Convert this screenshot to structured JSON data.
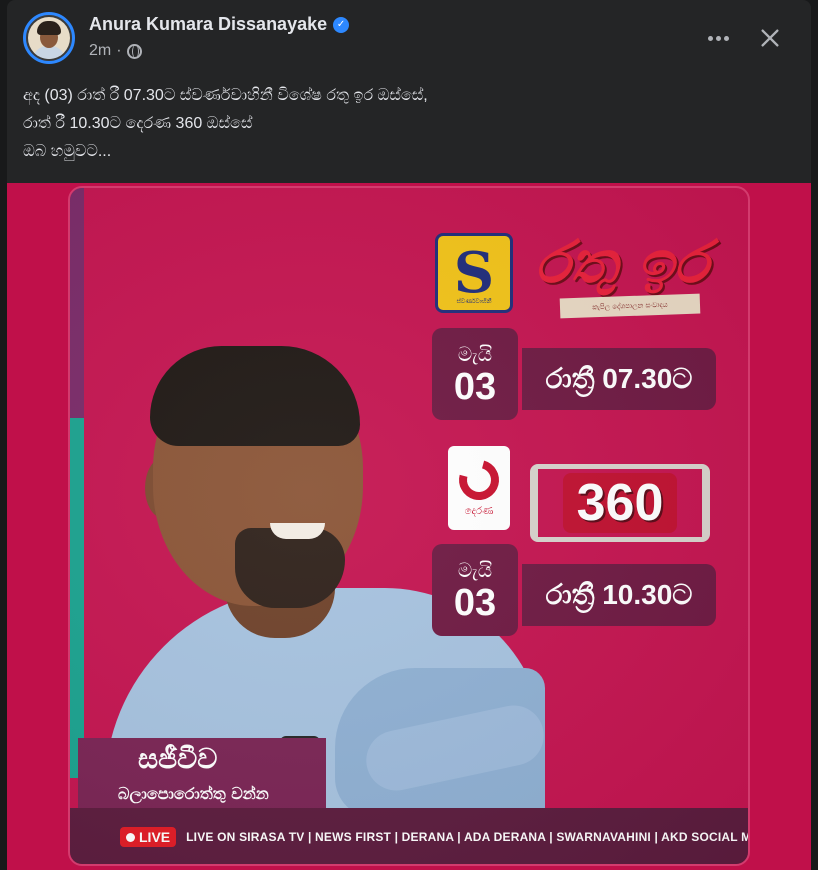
{
  "post": {
    "author_name": "Anura Kumara Dissanayake",
    "verified_badge": "✓",
    "timestamp": "2m",
    "separator": "·",
    "privacy_icon": "globe-icon",
    "more_icon": "more-options-icon",
    "close_icon": "close-icon",
    "caption_lines": [
      "අද (03) රාත් රී 07.30ට ස්වර්ණවාහිනී විශේෂ රතු ඉර ඔස්සේ,",
      "රාත් රී 10.30ට දෙරණ 360 ඔස්සේ",
      "ඔබ හමුවට..."
    ]
  },
  "poster": {
    "channel1_logo_text": "ස්වර්ණවාහිනී",
    "show1_title": "රතු ඉර",
    "show1_tagline": "කැපිල දේශපාලන සංවාදය",
    "slot1": {
      "month": "මැයි",
      "day": "03",
      "time": "රාත්‍රී 07.30ට"
    },
    "channel2_logo_text": "දෙරණ",
    "show2_title": "360",
    "slot2": {
      "month": "මැයි",
      "day": "03",
      "time": "රාත්‍රී 10.30ට"
    },
    "tagline_line1": "සජීවීව",
    "tagline_line2": "බලාපොරොත්තු වන්න",
    "live_label": "LIVE",
    "channels_text": "LIVE ON SIRASA TV | NEWS FIRST | DERANA | ADA DERANA | SWARNAVAHINI | AKD SOCIAL MEDIA"
  },
  "colors": {
    "poster_bg": "#c41450",
    "accent_box": "#6e1942",
    "live_red": "#e21b25",
    "verified_blue": "#2d88ff"
  }
}
